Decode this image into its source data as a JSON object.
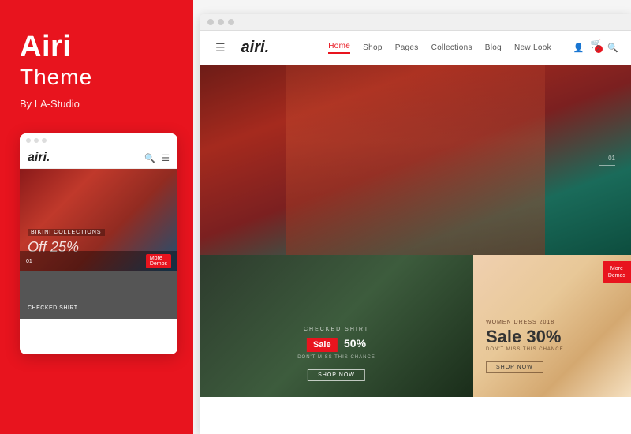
{
  "left": {
    "title": "Airi",
    "theme_label": "Theme",
    "by_label": "By LA-Studio",
    "mobile": {
      "dots": [
        "dot1",
        "dot2",
        "dot3"
      ],
      "logo": "airi.",
      "collection_tag": "BIKINI COLLECTIONS",
      "discount_text": "Off 25%",
      "page_num": "01",
      "more_demos": "More\nDemos",
      "bottom_tag": "CHECKED SHIRT"
    }
  },
  "right": {
    "browser_dots": [
      "dot1",
      "dot2",
      "dot3"
    ],
    "header": {
      "logo": "airi.",
      "nav_items": [
        {
          "label": "Home",
          "active": true
        },
        {
          "label": "Shop",
          "active": false
        },
        {
          "label": "Pages",
          "active": false
        },
        {
          "label": "Collections",
          "active": false
        },
        {
          "label": "Blog",
          "active": false
        },
        {
          "label": "New Look",
          "active": false
        }
      ]
    },
    "hero": {
      "pagination_num": "01"
    },
    "bottom_left": {
      "checked_shirt": "CHECKED SHIRT",
      "sale_label": "Sale",
      "sale_percent": "50%",
      "dont_miss": "DON'T MISS THIS CHANCE",
      "shop_now": "Shop Now"
    },
    "bottom_right": {
      "women_dress": "Women Dress 2018",
      "sale_label": "Sale 30%",
      "dont_miss": "DON'T MISS THIS CHANCE",
      "shop_now": "Shop Now"
    },
    "more_demos": "More\nDemos"
  }
}
